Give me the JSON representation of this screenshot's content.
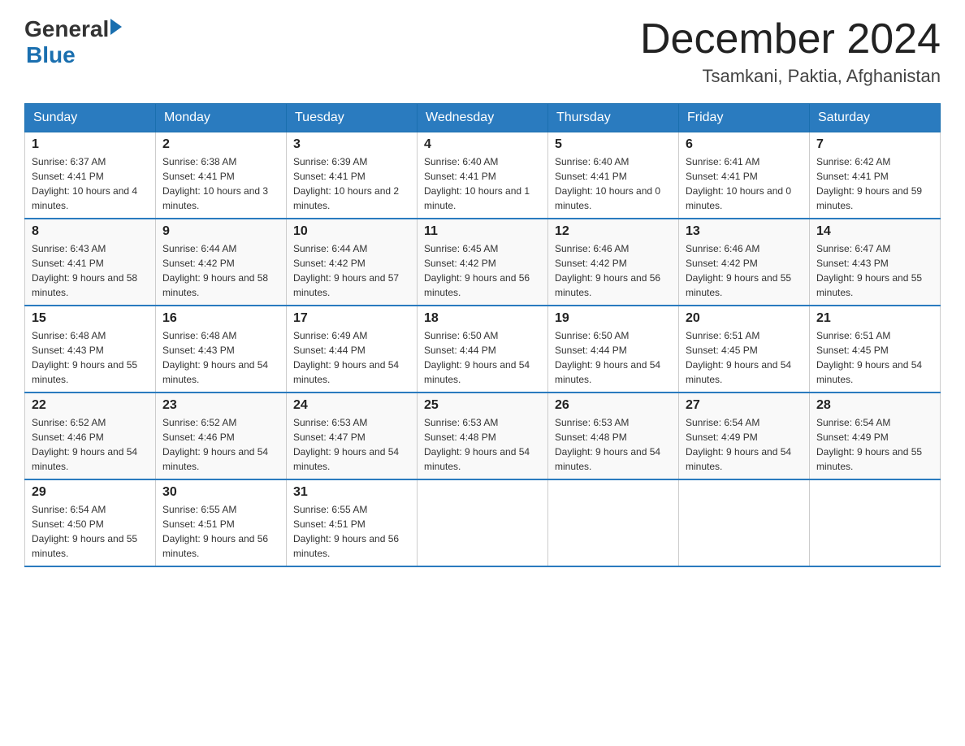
{
  "header": {
    "logo_general": "General",
    "logo_blue": "Blue",
    "month_year": "December 2024",
    "location": "Tsamkani, Paktia, Afghanistan"
  },
  "days_of_week": [
    "Sunday",
    "Monday",
    "Tuesday",
    "Wednesday",
    "Thursday",
    "Friday",
    "Saturday"
  ],
  "weeks": [
    [
      {
        "day": 1,
        "sunrise": "6:37 AM",
        "sunset": "4:41 PM",
        "daylight": "10 hours and 4 minutes."
      },
      {
        "day": 2,
        "sunrise": "6:38 AM",
        "sunset": "4:41 PM",
        "daylight": "10 hours and 3 minutes."
      },
      {
        "day": 3,
        "sunrise": "6:39 AM",
        "sunset": "4:41 PM",
        "daylight": "10 hours and 2 minutes."
      },
      {
        "day": 4,
        "sunrise": "6:40 AM",
        "sunset": "4:41 PM",
        "daylight": "10 hours and 1 minute."
      },
      {
        "day": 5,
        "sunrise": "6:40 AM",
        "sunset": "4:41 PM",
        "daylight": "10 hours and 0 minutes."
      },
      {
        "day": 6,
        "sunrise": "6:41 AM",
        "sunset": "4:41 PM",
        "daylight": "10 hours and 0 minutes."
      },
      {
        "day": 7,
        "sunrise": "6:42 AM",
        "sunset": "4:41 PM",
        "daylight": "9 hours and 59 minutes."
      }
    ],
    [
      {
        "day": 8,
        "sunrise": "6:43 AM",
        "sunset": "4:41 PM",
        "daylight": "9 hours and 58 minutes."
      },
      {
        "day": 9,
        "sunrise": "6:44 AM",
        "sunset": "4:42 PM",
        "daylight": "9 hours and 58 minutes."
      },
      {
        "day": 10,
        "sunrise": "6:44 AM",
        "sunset": "4:42 PM",
        "daylight": "9 hours and 57 minutes."
      },
      {
        "day": 11,
        "sunrise": "6:45 AM",
        "sunset": "4:42 PM",
        "daylight": "9 hours and 56 minutes."
      },
      {
        "day": 12,
        "sunrise": "6:46 AM",
        "sunset": "4:42 PM",
        "daylight": "9 hours and 56 minutes."
      },
      {
        "day": 13,
        "sunrise": "6:46 AM",
        "sunset": "4:42 PM",
        "daylight": "9 hours and 55 minutes."
      },
      {
        "day": 14,
        "sunrise": "6:47 AM",
        "sunset": "4:43 PM",
        "daylight": "9 hours and 55 minutes."
      }
    ],
    [
      {
        "day": 15,
        "sunrise": "6:48 AM",
        "sunset": "4:43 PM",
        "daylight": "9 hours and 55 minutes."
      },
      {
        "day": 16,
        "sunrise": "6:48 AM",
        "sunset": "4:43 PM",
        "daylight": "9 hours and 54 minutes."
      },
      {
        "day": 17,
        "sunrise": "6:49 AM",
        "sunset": "4:44 PM",
        "daylight": "9 hours and 54 minutes."
      },
      {
        "day": 18,
        "sunrise": "6:50 AM",
        "sunset": "4:44 PM",
        "daylight": "9 hours and 54 minutes."
      },
      {
        "day": 19,
        "sunrise": "6:50 AM",
        "sunset": "4:44 PM",
        "daylight": "9 hours and 54 minutes."
      },
      {
        "day": 20,
        "sunrise": "6:51 AM",
        "sunset": "4:45 PM",
        "daylight": "9 hours and 54 minutes."
      },
      {
        "day": 21,
        "sunrise": "6:51 AM",
        "sunset": "4:45 PM",
        "daylight": "9 hours and 54 minutes."
      }
    ],
    [
      {
        "day": 22,
        "sunrise": "6:52 AM",
        "sunset": "4:46 PM",
        "daylight": "9 hours and 54 minutes."
      },
      {
        "day": 23,
        "sunrise": "6:52 AM",
        "sunset": "4:46 PM",
        "daylight": "9 hours and 54 minutes."
      },
      {
        "day": 24,
        "sunrise": "6:53 AM",
        "sunset": "4:47 PM",
        "daylight": "9 hours and 54 minutes."
      },
      {
        "day": 25,
        "sunrise": "6:53 AM",
        "sunset": "4:48 PM",
        "daylight": "9 hours and 54 minutes."
      },
      {
        "day": 26,
        "sunrise": "6:53 AM",
        "sunset": "4:48 PM",
        "daylight": "9 hours and 54 minutes."
      },
      {
        "day": 27,
        "sunrise": "6:54 AM",
        "sunset": "4:49 PM",
        "daylight": "9 hours and 54 minutes."
      },
      {
        "day": 28,
        "sunrise": "6:54 AM",
        "sunset": "4:49 PM",
        "daylight": "9 hours and 55 minutes."
      }
    ],
    [
      {
        "day": 29,
        "sunrise": "6:54 AM",
        "sunset": "4:50 PM",
        "daylight": "9 hours and 55 minutes."
      },
      {
        "day": 30,
        "sunrise": "6:55 AM",
        "sunset": "4:51 PM",
        "daylight": "9 hours and 56 minutes."
      },
      {
        "day": 31,
        "sunrise": "6:55 AM",
        "sunset": "4:51 PM",
        "daylight": "9 hours and 56 minutes."
      },
      null,
      null,
      null,
      null
    ]
  ]
}
